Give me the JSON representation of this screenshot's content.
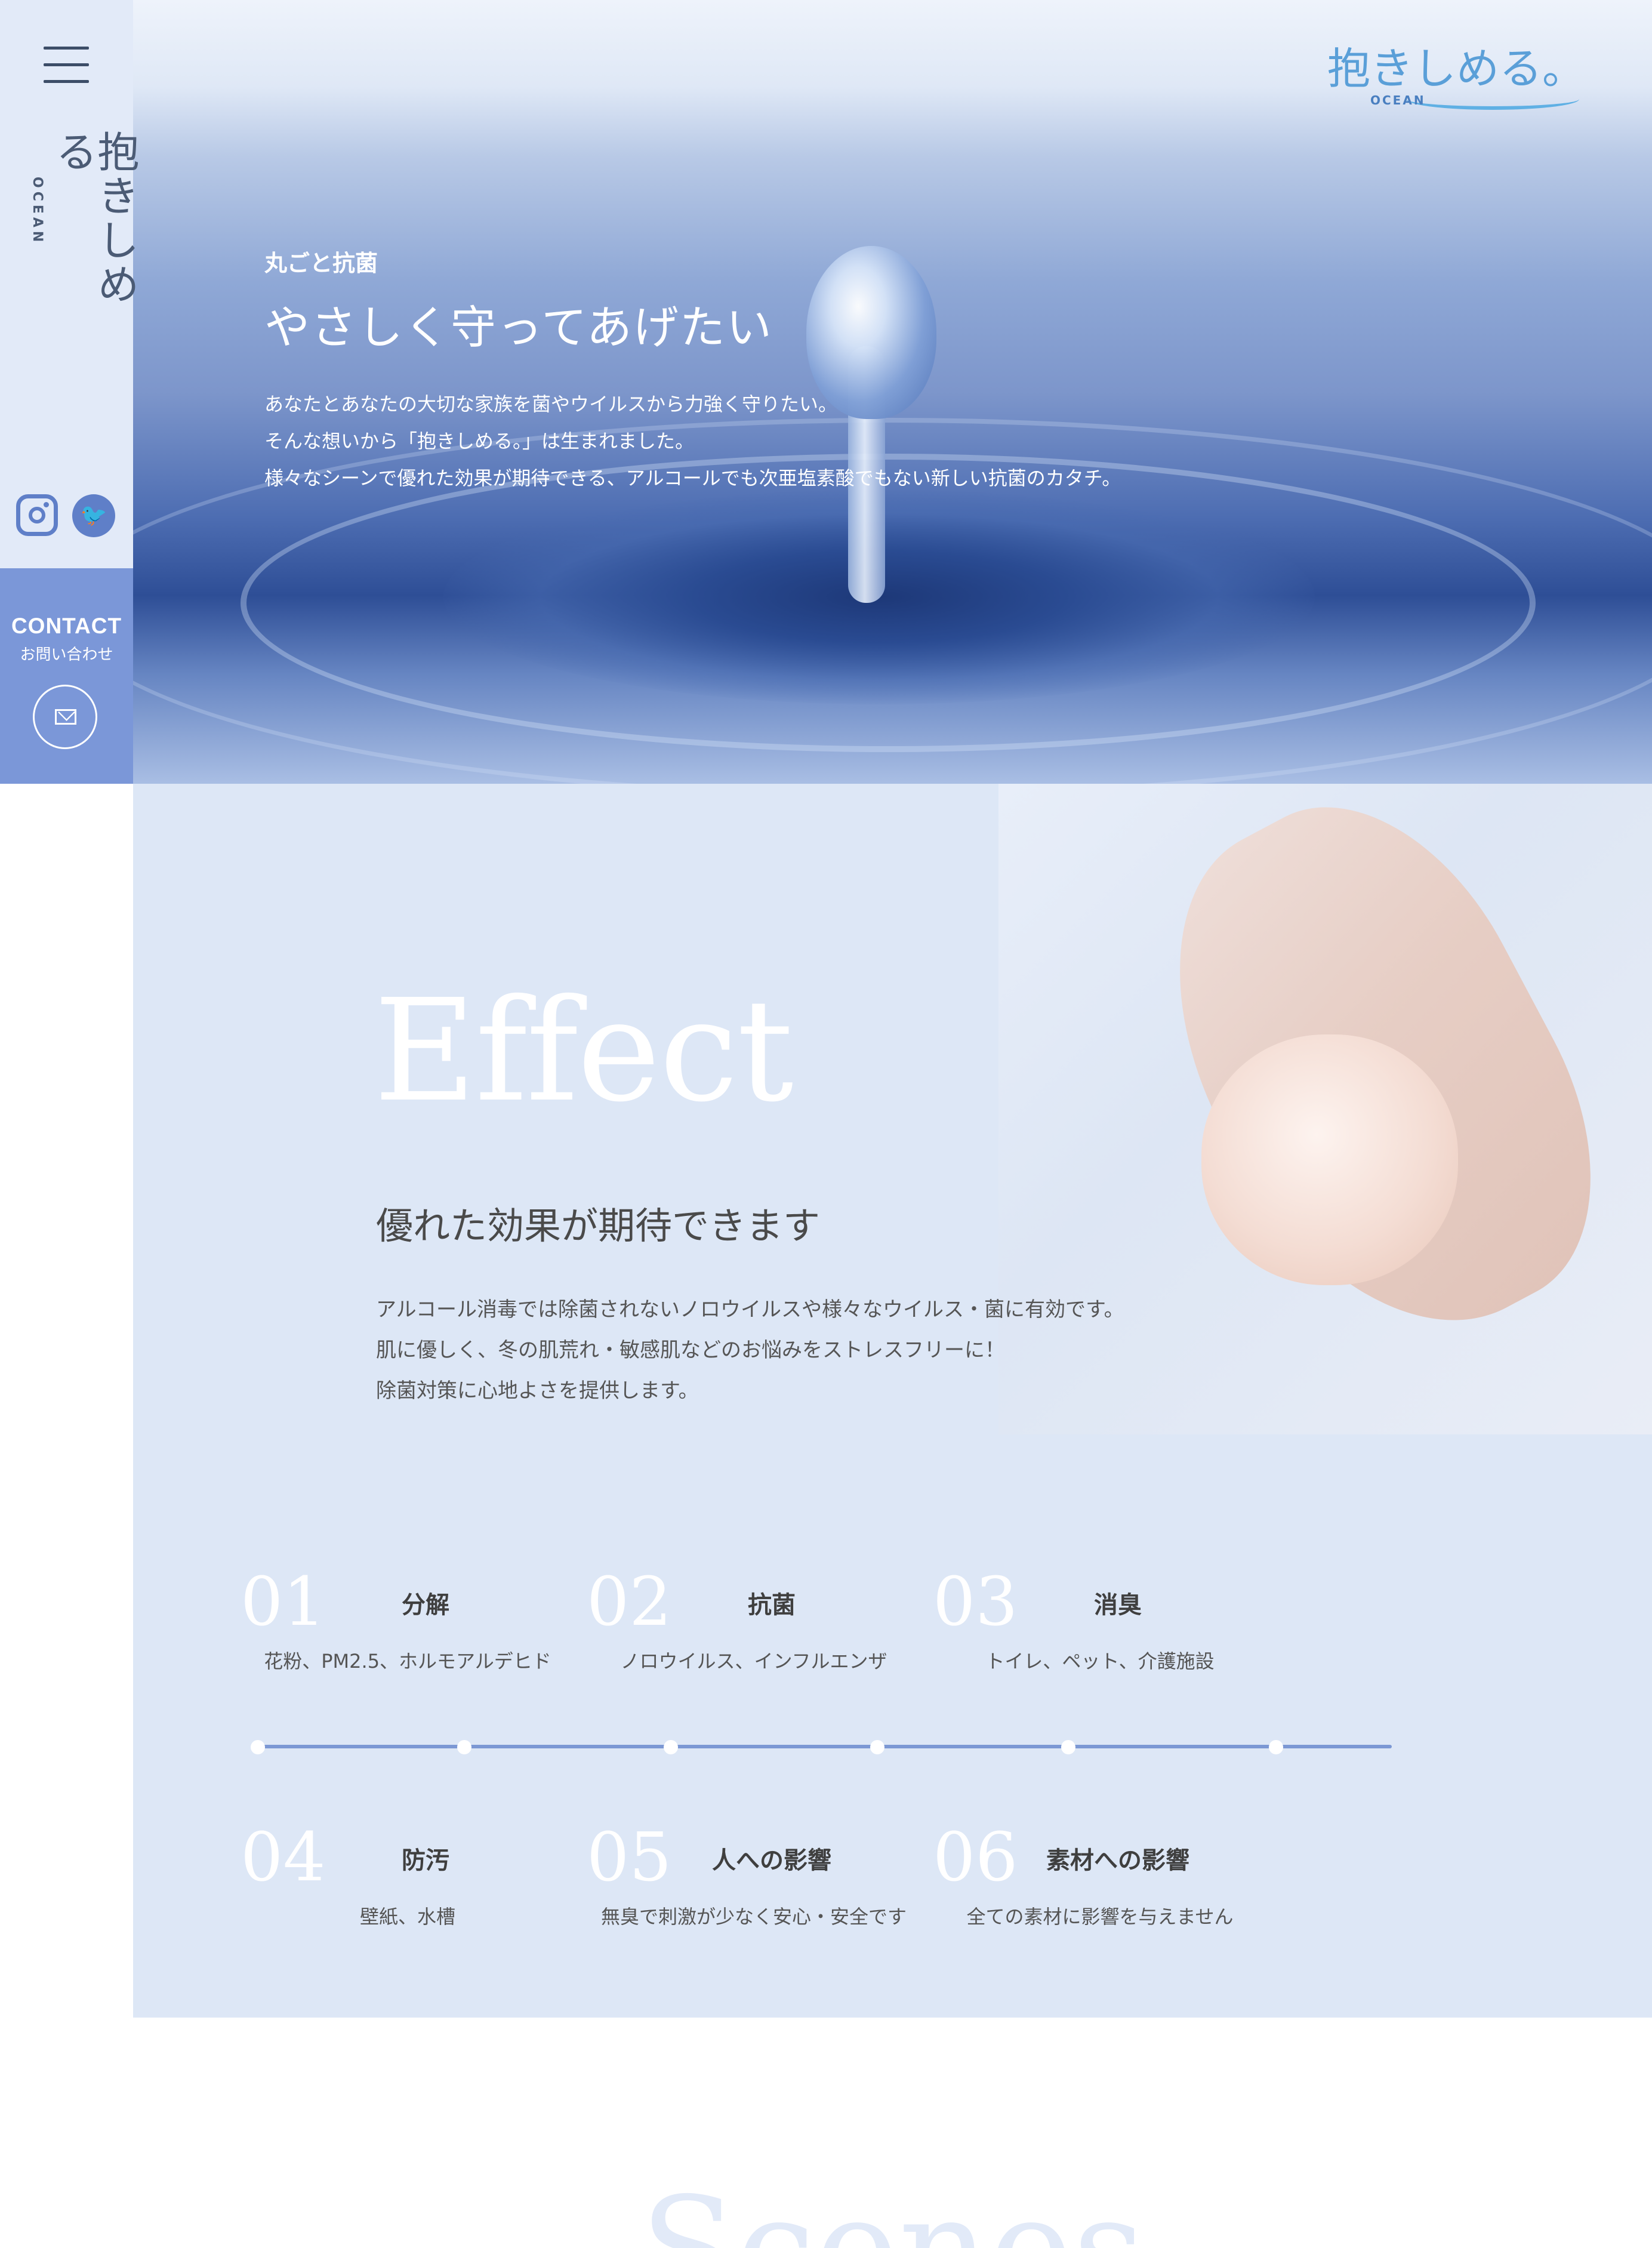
{
  "sidebar": {
    "logo_main": "抱きしめる",
    "logo_sub": "OCEAN",
    "contact_en": "CONTACT",
    "contact_ja": "お問い合わせ"
  },
  "brand": {
    "logo_main": "抱きしめる。",
    "logo_sub": "OCEAN"
  },
  "hero": {
    "small_title": "丸ごと抗菌",
    "title": "やさしく守ってあげたい",
    "lines": [
      "あなたとあなたの大切な家族を菌やウイルスから力強く守りたい。",
      "そんな想いから「抱きしめる。」は生まれました。",
      "様々なシーンで優れた効果が期待できる、アルコールでも次亜塩素酸でもない新しい抗菌のカタチ。"
    ]
  },
  "effect": {
    "heading": "Effect",
    "subtitle": "優れた効果が期待できます",
    "lines": [
      "アルコール消毒では除菌されないノロウイルスや様々なウイルス・菌に有効です。",
      "肌に優しく、冬の肌荒れ・敏感肌などのお悩みをストレスフリーに！",
      "除菌対策に心地よさを提供します。"
    ],
    "features": [
      {
        "num": "01",
        "title": "分解",
        "desc": "花粉、PM2.5、ホルモアルデヒド"
      },
      {
        "num": "02",
        "title": "抗菌",
        "desc": "ノロウイルス、インフルエンザ"
      },
      {
        "num": "03",
        "title": "消臭",
        "desc": "トイレ、ペット、介護施設"
      },
      {
        "num": "04",
        "title": "防汚",
        "desc": "壁紙、水槽"
      },
      {
        "num": "05",
        "title": "人への影響",
        "desc": "無臭で刺激が少なく安心・安全です"
      },
      {
        "num": "06",
        "title": "素材への影響",
        "desc": "全ての素材に影響を与えません"
      }
    ]
  },
  "scenes": {
    "heading": "Scenes"
  },
  "colors": {
    "sidebar_bg": "#e2eaf8",
    "contact_bg": "#7b97d8",
    "accent": "#5f7fc8",
    "effect_bg": "#dde7f6"
  },
  "icons": [
    "menu-icon",
    "instagram-icon",
    "twitter-icon",
    "mail-icon"
  ]
}
